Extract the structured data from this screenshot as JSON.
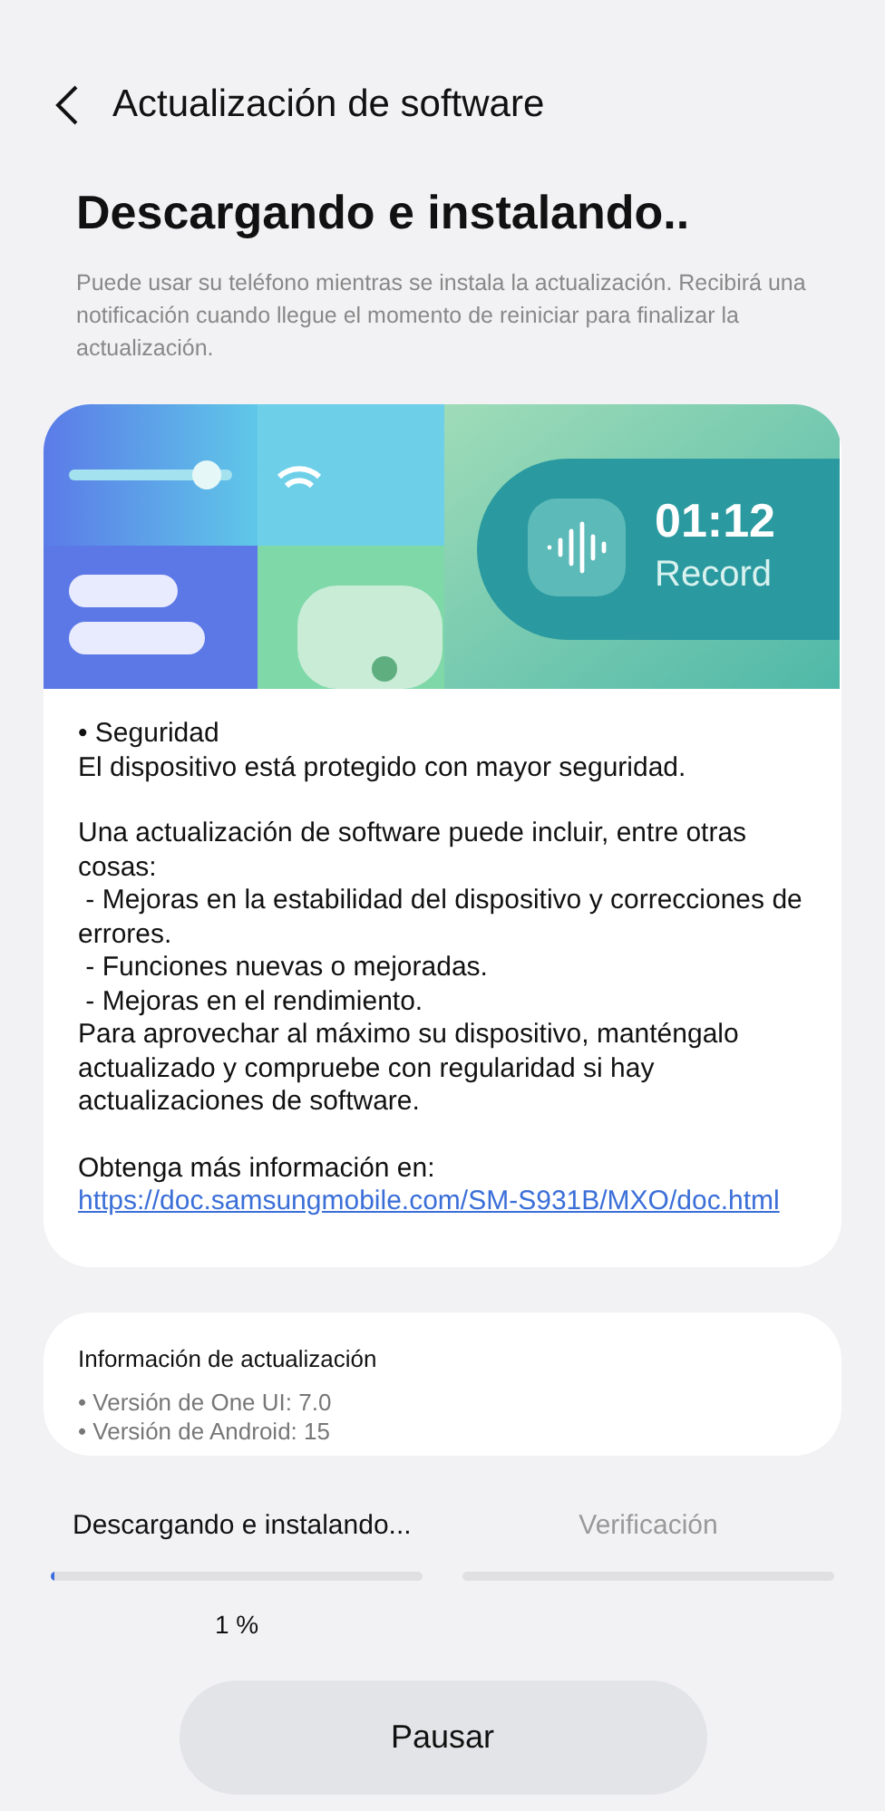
{
  "header": {
    "title": "Actualización de software"
  },
  "heading": "Descargando e instalando..",
  "description": "Puede usar su teléfono mientras se instala la actualización. Recibirá una notificación cuando llegue el momento de reiniciar para finalizar la actualización.",
  "banner": {
    "time": "01:12",
    "label": "Record"
  },
  "notes": [
    {
      "lines": [
        "• Seguridad",
        "El dispositivo está protegido con mayor seguridad."
      ]
    },
    {
      "lines": [
        "Una actualización de software puede incluir, entre otras cosas:",
        " - Mejoras en la estabilidad del dispositivo y correcciones de errores.",
        " - Funciones nuevas o mejoradas.",
        " - Mejoras en el rendimiento.",
        "Para aprovechar al máximo su dispositivo, manténgalo actualizado y compruebe con regularidad si hay actualizaciones de software."
      ]
    },
    {
      "lines": [
        "Obtenga más información en:"
      ],
      "link": "https://doc.samsungmobile.com/SM-S931B/MXO/doc.html"
    }
  ],
  "update_info": {
    "title": "Información de actualización",
    "items": [
      "• Versión de One UI: 7.0",
      "• Versión de Android: 15"
    ]
  },
  "steps": [
    {
      "label": "Descargando e instalando...",
      "active": true,
      "level": 0.01,
      "reading": "1 %"
    },
    {
      "label": "Verificación",
      "active": false
    }
  ],
  "button": "Pausar"
}
